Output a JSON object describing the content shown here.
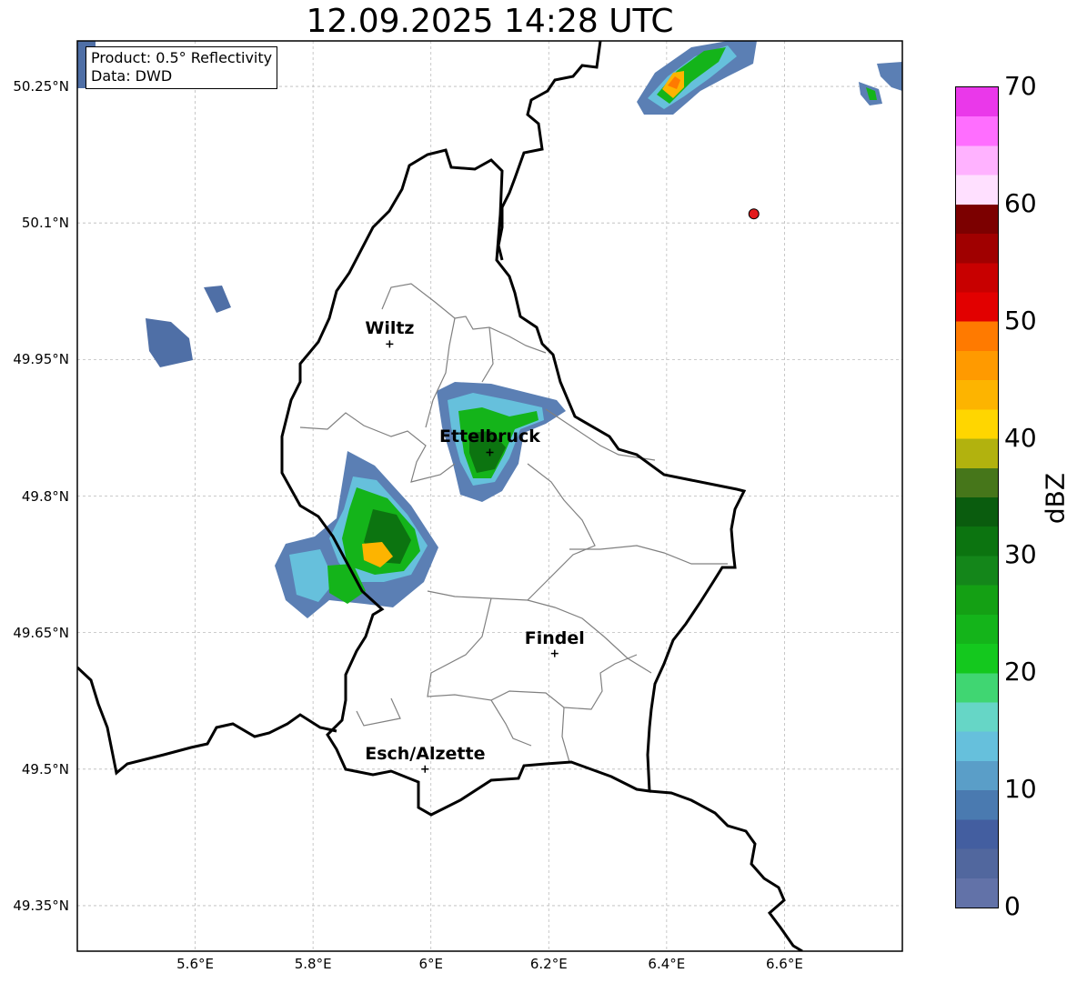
{
  "title": "12.09.2025 14:28 UTC",
  "info": {
    "product": "Product: 0.5° Reflectivity",
    "data": "Data: DWD"
  },
  "map": {
    "lon_range": [
      5.4,
      6.8
    ],
    "lat_range": [
      49.3,
      50.3
    ],
    "gridlines": true,
    "lat_ticks": [
      {
        "value": 50.25,
        "label": "50.25°N"
      },
      {
        "value": 50.1,
        "label": "50.1°N"
      },
      {
        "value": 49.95,
        "label": "49.95°N"
      },
      {
        "value": 49.8,
        "label": "49.8°N"
      },
      {
        "value": 49.65,
        "label": "49.65°N"
      },
      {
        "value": 49.5,
        "label": "49.5°N"
      },
      {
        "value": 49.35,
        "label": "49.35°N"
      }
    ],
    "lon_ticks": [
      {
        "value": 5.6,
        "label": "5.6°E"
      },
      {
        "value": 5.8,
        "label": "5.8°E"
      },
      {
        "value": 6.0,
        "label": "6°E"
      },
      {
        "value": 6.2,
        "label": "6.2°E"
      },
      {
        "value": 6.4,
        "label": "6.4°E"
      },
      {
        "value": 6.6,
        "label": "6.6°E"
      }
    ],
    "cities": [
      {
        "name": "Wiltz",
        "lon": 5.93,
        "lat": 49.967
      },
      {
        "name": "Ettelbruck",
        "lon": 6.1,
        "lat": 49.848
      },
      {
        "name": "Findel",
        "lon": 6.21,
        "lat": 49.627
      },
      {
        "name": "Esch/Alzette",
        "lon": 5.99,
        "lat": 49.5
      }
    ],
    "radar_site": {
      "lon": 6.548,
      "lat": 50.11,
      "color": "#e31a1c"
    }
  },
  "colorbar": {
    "label": "dBZ",
    "min": 0,
    "max": 70,
    "ticks": [
      "0",
      "10",
      "20",
      "30",
      "40",
      "50",
      "60",
      "70"
    ],
    "colors": [
      "#6272a8",
      "#51679e",
      "#435ea0",
      "#4a7ab0",
      "#5a9ec8",
      "#66c0dc",
      "#66d6c6",
      "#40d672",
      "#14c81e",
      "#14b41a",
      "#14a014",
      "#14861a",
      "#0c7410",
      "#0a5c0e",
      "#46761a",
      "#b2b20e",
      "#ffd600",
      "#fdb400",
      "#ff9a00",
      "#ff7a00",
      "#e20000",
      "#c80000",
      "#a00000",
      "#7c0000",
      "#ffe0ff",
      "#ffb2ff",
      "#ff6eff",
      "#ea38ea"
    ]
  }
}
